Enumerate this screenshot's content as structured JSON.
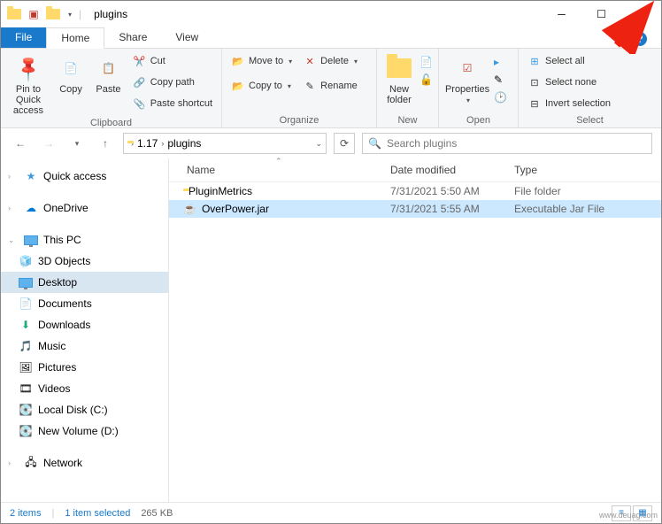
{
  "title": "plugins",
  "tabs": {
    "file": "File",
    "home": "Home",
    "share": "Share",
    "view": "View"
  },
  "ribbon": {
    "clipboard": {
      "label": "Clipboard",
      "pin": "Pin to Quick\naccess",
      "copy": "Copy",
      "paste": "Paste",
      "cut": "Cut",
      "copy_path": "Copy path",
      "paste_shortcut": "Paste shortcut"
    },
    "organize": {
      "label": "Organize",
      "move_to": "Move to",
      "copy_to": "Copy to",
      "delete": "Delete",
      "rename": "Rename"
    },
    "new": {
      "label": "New",
      "new_folder": "New\nfolder"
    },
    "open": {
      "label": "Open",
      "properties": "Properties"
    },
    "select": {
      "label": "Select",
      "select_all": "Select all",
      "select_none": "Select none",
      "invert": "Invert selection"
    }
  },
  "breadcrumb": {
    "parts": [
      "1.17",
      "plugins"
    ]
  },
  "search_placeholder": "Search plugins",
  "sidebar": {
    "quick_access": "Quick access",
    "onedrive": "OneDrive",
    "this_pc": "This PC",
    "items": [
      "3D Objects",
      "Desktop",
      "Documents",
      "Downloads",
      "Music",
      "Pictures",
      "Videos",
      "Local Disk (C:)",
      "New Volume (D:)"
    ],
    "network": "Network"
  },
  "columns": {
    "name": "Name",
    "date": "Date modified",
    "type": "Type"
  },
  "files": [
    {
      "name": "PluginMetrics",
      "date": "7/31/2021 5:50 AM",
      "type": "File folder",
      "kind": "folder"
    },
    {
      "name": "OverPower.jar",
      "date": "7/31/2021 5:55 AM",
      "type": "Executable Jar File",
      "kind": "jar"
    }
  ],
  "status": {
    "count": "2 items",
    "selected": "1 item selected",
    "size": "265 KB"
  },
  "watermark": "www.deuag.com"
}
